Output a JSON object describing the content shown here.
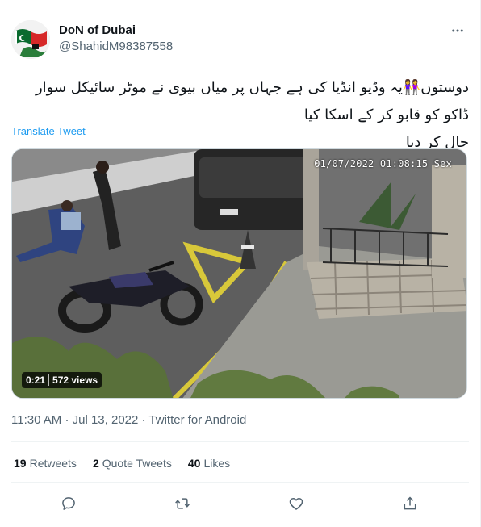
{
  "author": {
    "display_name": "DoN of Dubai",
    "handle": "@ShahidM98387558",
    "avatar_icon": "avatar-flags-icon"
  },
  "more_icon": "more-horizontal-icon",
  "tweet": {
    "text_line1": "دوستوں👭یہ وڈیو انڈیا کی ہے جہاں پر میاں بیوی نے موٹر سائیکل سوار ڈاکو کو قابو کر کے اسکا کیا",
    "text_line2": "حال کر دیا",
    "translate_label": "Translate Tweet"
  },
  "media": {
    "camera_timestamp": "01/07/2022 01:08:15 Sex",
    "duration": "0:21",
    "views": "572 views"
  },
  "meta": {
    "time": "11:30 AM",
    "date": "Jul 13, 2022",
    "separator": "·",
    "source": "Twitter for Android"
  },
  "stats": {
    "retweets_count": "19",
    "retweets_label": "Retweets",
    "quotes_count": "2",
    "quotes_label": "Quote Tweets",
    "likes_count": "40",
    "likes_label": "Likes"
  },
  "actions": [
    "reply-icon",
    "retweet-icon",
    "like-icon",
    "share-icon"
  ],
  "colors": {
    "link": "#1d9bf0",
    "secondary_text": "#536471",
    "primary_text": "#0f1419"
  }
}
